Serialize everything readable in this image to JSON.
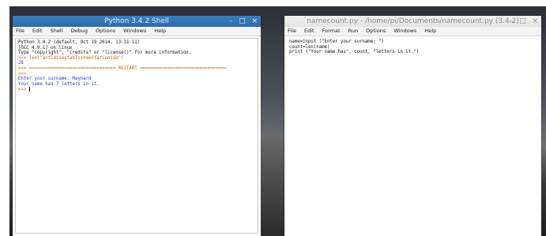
{
  "shell_window": {
    "title": "Python 3.4.2 Shell",
    "controls": [
      "–",
      "□",
      "×"
    ],
    "menu": [
      "File",
      "Edit",
      "Shell",
      "Debug",
      "Options",
      "Windows",
      "Help"
    ],
    "lines": [
      {
        "text": "Python 3.4.2 (default, Oct 19 2014, 13:31:11)",
        "color": "#111111"
      },
      {
        "text": "[GCC 4.9.1] on linux",
        "color": "#111111"
      },
      {
        "text": "Type \"copyright\", \"credits\" or \"license()\" for more information.",
        "color": "#111111"
      },
      {
        "text": ">>> len(\"antidisestablishmentarianism\")",
        "color": "#c56a00"
      },
      {
        "text": "28",
        "color": "#2a3fbf"
      },
      {
        "text": ">>> ================================ RESTART ================================",
        "color": "#c56a00"
      },
      {
        "text": ">>>",
        "color": "#c56a00"
      },
      {
        "text": "Enter your surname: Maynard",
        "color": "#2a3fbf"
      },
      {
        "text": "Your name has 7 letters in it.",
        "color": "#2a3fbf"
      },
      {
        "text": ">>> ",
        "color": "#c56a00"
      }
    ]
  },
  "editor_window": {
    "title": "namecount.py - /home/pi/Documents/namecount.py (3.4.2)",
    "controls": [
      "–",
      "□",
      "×"
    ],
    "menu": [
      "File",
      "Edit",
      "Format",
      "Run",
      "Options",
      "Windows",
      "Help"
    ],
    "lines": [
      {
        "text": "name=input (\"Enter your surname: \")",
        "color": "#111111"
      },
      {
        "text": "count=len(name)",
        "color": "#111111"
      },
      {
        "text": "print (\"Your name has\", count, \"letters in it.\")",
        "color": "#111111"
      }
    ]
  }
}
